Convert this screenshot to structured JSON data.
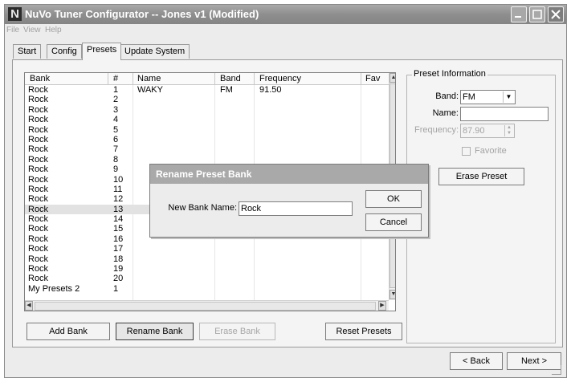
{
  "window": {
    "title": "NuVo Tuner Configurator -- Jones v1 (Modified)",
    "logo": "N"
  },
  "menu": [
    "File",
    "View",
    "Help"
  ],
  "tabs": [
    {
      "label": "Start",
      "active": false
    },
    {
      "label": "Config",
      "active": false
    },
    {
      "label": "Presets",
      "active": true
    },
    {
      "label": "Update System",
      "active": false
    }
  ],
  "presets_table": {
    "columns": [
      "Bank",
      "#",
      "Name",
      "Band",
      "Frequency",
      "Fav"
    ],
    "rows": [
      {
        "bank": "Rock",
        "num": "1",
        "name": "WAKY",
        "band": "FM",
        "frequency": "91.50",
        "fav": ""
      },
      {
        "bank": "Rock",
        "num": "2",
        "name": "",
        "band": "",
        "frequency": "",
        "fav": ""
      },
      {
        "bank": "Rock",
        "num": "3",
        "name": "",
        "band": "",
        "frequency": "",
        "fav": ""
      },
      {
        "bank": "Rock",
        "num": "4",
        "name": "",
        "band": "",
        "frequency": "",
        "fav": ""
      },
      {
        "bank": "Rock",
        "num": "5",
        "name": "",
        "band": "",
        "frequency": "",
        "fav": ""
      },
      {
        "bank": "Rock",
        "num": "6",
        "name": "",
        "band": "",
        "frequency": "",
        "fav": ""
      },
      {
        "bank": "Rock",
        "num": "7",
        "name": "",
        "band": "",
        "frequency": "",
        "fav": ""
      },
      {
        "bank": "Rock",
        "num": "8",
        "name": "",
        "band": "",
        "frequency": "",
        "fav": ""
      },
      {
        "bank": "Rock",
        "num": "9",
        "name": "",
        "band": "",
        "frequency": "",
        "fav": ""
      },
      {
        "bank": "Rock",
        "num": "10",
        "name": "",
        "band": "",
        "frequency": "",
        "fav": ""
      },
      {
        "bank": "Rock",
        "num": "11",
        "name": "",
        "band": "",
        "frequency": "",
        "fav": ""
      },
      {
        "bank": "Rock",
        "num": "12",
        "name": "",
        "band": "",
        "frequency": "",
        "fav": ""
      },
      {
        "bank": "Rock",
        "num": "13",
        "name": "",
        "band": "",
        "frequency": "",
        "fav": "",
        "selected": true
      },
      {
        "bank": "Rock",
        "num": "14",
        "name": "",
        "band": "",
        "frequency": "",
        "fav": ""
      },
      {
        "bank": "Rock",
        "num": "15",
        "name": "",
        "band": "",
        "frequency": "",
        "fav": ""
      },
      {
        "bank": "Rock",
        "num": "16",
        "name": "",
        "band": "",
        "frequency": "",
        "fav": ""
      },
      {
        "bank": "Rock",
        "num": "17",
        "name": "",
        "band": "",
        "frequency": "",
        "fav": ""
      },
      {
        "bank": "Rock",
        "num": "18",
        "name": "",
        "band": "",
        "frequency": "",
        "fav": ""
      },
      {
        "bank": "Rock",
        "num": "19",
        "name": "",
        "band": "",
        "frequency": "",
        "fav": ""
      },
      {
        "bank": "Rock",
        "num": "20",
        "name": "",
        "band": "",
        "frequency": "",
        "fav": ""
      },
      {
        "bank": "My Presets 2",
        "num": "1",
        "name": "",
        "band": "",
        "frequency": "",
        "fav": ""
      }
    ]
  },
  "bank_buttons": {
    "add": "Add Bank",
    "rename": "Rename Bank",
    "erase": "Erase Bank",
    "reset": "Reset Presets"
  },
  "preset_info": {
    "title": "Preset Information",
    "band_label": "Band:",
    "band_value": "FM",
    "name_label": "Name:",
    "name_value": "",
    "frequency_label": "Frequency:",
    "frequency_value": "87.90",
    "favorite_label": "Favorite",
    "erase_button": "Erase Preset"
  },
  "dialog": {
    "title": "Rename Preset Bank",
    "field_label": "New Bank Name:",
    "field_value": "Rock",
    "ok": "OK",
    "cancel": "Cancel"
  },
  "nav": {
    "back": "< Back",
    "next": "Next >"
  },
  "icons": {
    "minimize": "minimize-icon",
    "maximize": "maximize-icon",
    "close": "close-icon"
  }
}
